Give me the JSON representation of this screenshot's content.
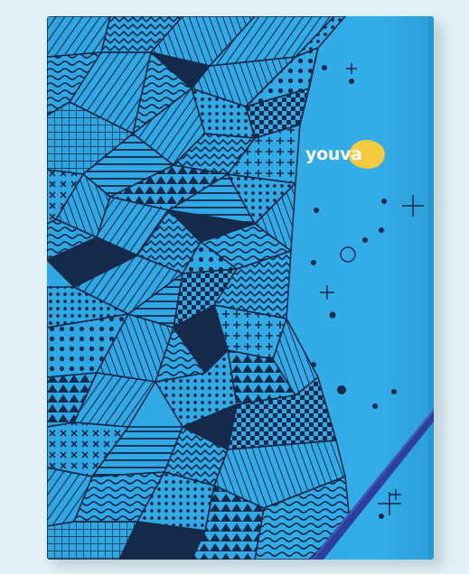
{
  "photo": {
    "subject": "notebook-with-geometric-cover",
    "colors": {
      "background": "#e3f1f6",
      "cover": "#2fa8e4",
      "pattern_dark": "#15294a",
      "logo_blob": "#f7c93d",
      "logo_text": "#ffffff",
      "strap": "#2d3f9a"
    }
  },
  "brand": {
    "logo_text": "youva"
  }
}
